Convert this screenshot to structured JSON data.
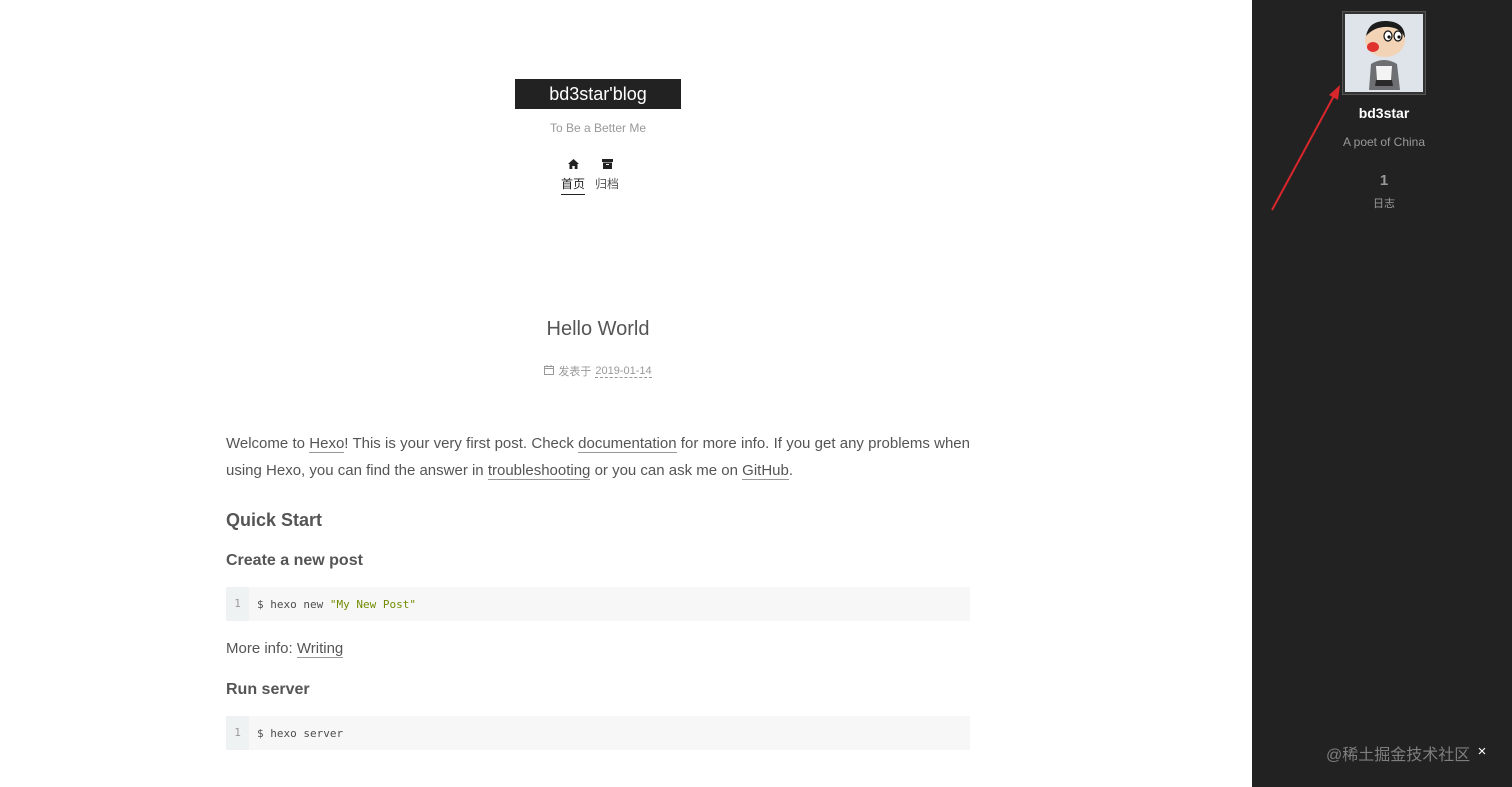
{
  "site": {
    "title": "bd3star'blog",
    "subtitle": "To Be a Better Me"
  },
  "menu": [
    {
      "label": "首页",
      "icon": "home-icon",
      "active": true
    },
    {
      "label": "归档",
      "icon": "archive-icon",
      "active": false
    }
  ],
  "post": {
    "title": "Hello World",
    "meta_label": "发表于",
    "date": "2019-01-14",
    "intro": {
      "t1": "Welcome to ",
      "link_hexo": "Hexo",
      "t2": "! This is your very first post. Check ",
      "link_docs": "documentation",
      "t3": " for more info. If you get any problems when using Hexo, you can find the answer in ",
      "link_trouble": "troubleshooting",
      "t4": " or you can ask me on ",
      "link_github": "GitHub",
      "t5": "."
    },
    "h2_quick_start": "Quick Start",
    "h3_create_post": "Create a new post",
    "code1": {
      "line_no": "1",
      "cmd": "$ hexo new ",
      "str": "\"My New Post\""
    },
    "more_info_label": "More info: ",
    "more_info_link": "Writing",
    "h3_run_server": "Run server",
    "code2": {
      "line_no": "1",
      "cmd": "$ hexo server"
    }
  },
  "sidebar": {
    "author_name": "bd3star",
    "author_desc": "A poet of China",
    "posts_count": "1",
    "posts_label": "日志",
    "colors": {
      "background": "#222222",
      "arrow": "#d9262c"
    }
  },
  "watermark": "@稀土掘金技术社区",
  "close_symbol": "×"
}
